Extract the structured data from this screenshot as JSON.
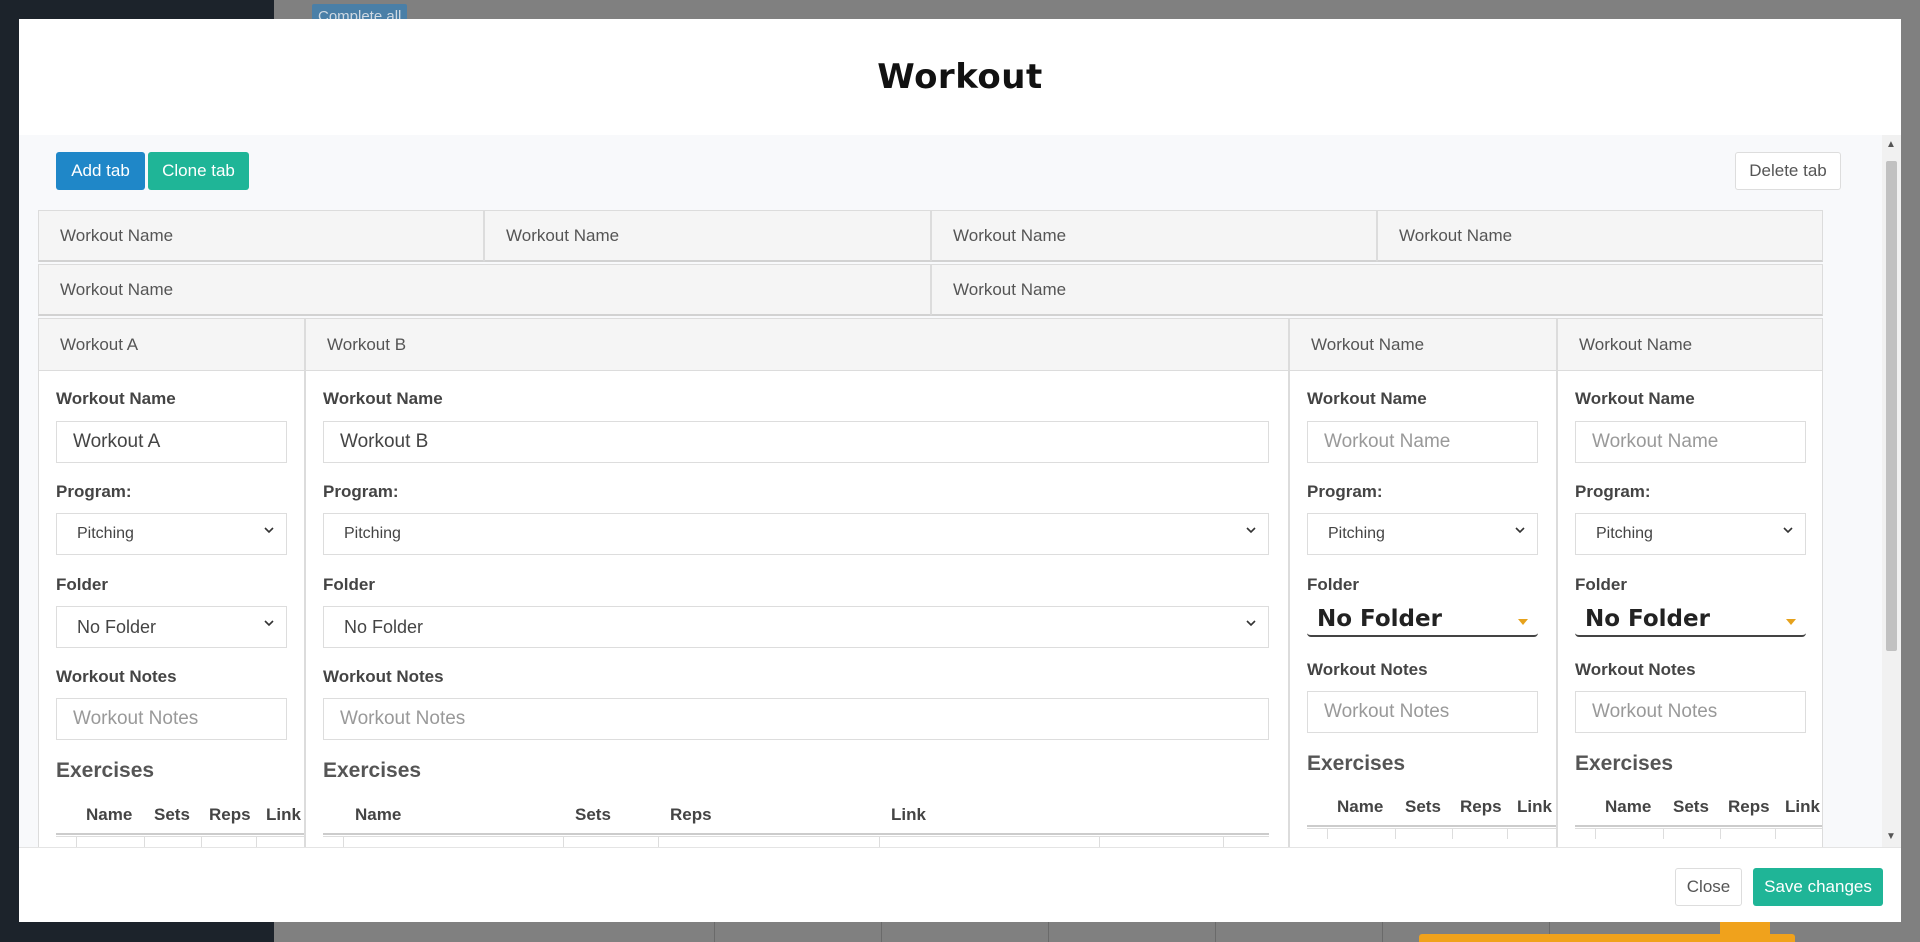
{
  "background": {
    "complete_all_label": "Complete all"
  },
  "modal": {
    "title": "Workout",
    "toolbar": {
      "add_tab": "Add tab",
      "clone_tab": "Clone tab",
      "delete_tab": "Delete tab"
    },
    "tab_row_1": [
      "Workout Name",
      "Workout Name",
      "Workout Name",
      "Workout Name"
    ],
    "tab_row_2": [
      "Workout Name",
      "Workout Name"
    ],
    "labels": {
      "workout_name": "Workout Name",
      "program": "Program:",
      "folder": "Folder",
      "workout_notes": "Workout Notes",
      "exercises": "Exercises"
    },
    "table_headers": {
      "name": "Name",
      "sets": "Sets",
      "reps": "Reps",
      "link": "Link"
    },
    "columns": [
      {
        "header": "Workout A",
        "name_value": "Workout A",
        "name_placeholder": "Workout Name",
        "program": "Pitching",
        "folder": "No Folder",
        "notes_placeholder": "Workout Notes"
      },
      {
        "header": "Workout B",
        "name_value": "Workout B",
        "name_placeholder": "Workout Name",
        "program": "Pitching",
        "folder": "No Folder",
        "notes_placeholder": "Workout Notes"
      },
      {
        "header": "Workout Name",
        "name_value": "",
        "name_placeholder": "Workout Name",
        "program": "Pitching",
        "folder": "No Folder",
        "notes_placeholder": "Workout Notes"
      },
      {
        "header": "Workout Name",
        "name_value": "",
        "name_placeholder": "Workout Name",
        "program": "Pitching",
        "folder": "No Folder",
        "notes_placeholder": "Workout Notes"
      }
    ],
    "footer": {
      "close": "Close",
      "save": "Save changes"
    },
    "scroll_up_arrow": "▲",
    "scroll_down_arrow": "▼"
  },
  "colors": {
    "primary": "#1f87c8",
    "success": "#1fb597",
    "accent": "#f0a21c"
  }
}
